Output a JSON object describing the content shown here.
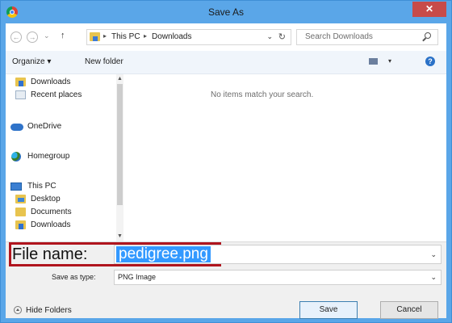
{
  "window": {
    "title": "Save As",
    "close_label": "✕"
  },
  "nav": {
    "back": "←",
    "forward": "→",
    "recent": "⌄",
    "up": "↑",
    "breadcrumb": [
      "This PC",
      "Downloads"
    ],
    "breadcrumb_sep": "▸",
    "dropdown": "⌄",
    "refresh": "↻"
  },
  "search": {
    "placeholder": "Search Downloads"
  },
  "toolbar": {
    "organize": "Organize ▾",
    "new_folder": "New folder",
    "view_dropdown": "▾",
    "help": "?"
  },
  "sidebar": {
    "items": [
      {
        "label": "Downloads",
        "icon": "downloads-folder-icon"
      },
      {
        "label": "Recent places",
        "icon": "recent-places-icon"
      },
      {
        "label": "OneDrive",
        "icon": "onedrive-icon"
      },
      {
        "label": "Homegroup",
        "icon": "homegroup-icon"
      },
      {
        "label": "This PC",
        "icon": "this-pc-icon"
      },
      {
        "label": "Desktop",
        "icon": "desktop-folder-icon"
      },
      {
        "label": "Documents",
        "icon": "documents-folder-icon"
      },
      {
        "label": "Downloads",
        "icon": "downloads-folder-icon"
      }
    ],
    "scroll_up": "▲",
    "scroll_down": "▼"
  },
  "main": {
    "empty_message": "No items match your search."
  },
  "form": {
    "file_name_label": "File name:",
    "file_name_value": "pedigree.png",
    "save_as_type_label": "Save as type:",
    "save_as_type_value": "PNG Image",
    "dropdown": "⌄"
  },
  "footer": {
    "hide_folders": "Hide Folders",
    "save": "Save",
    "cancel": "Cancel"
  },
  "colors": {
    "titlebar": "#5aa6e8",
    "close": "#c74b49",
    "highlight_box": "#b0151e",
    "selection": "#3399ff"
  }
}
